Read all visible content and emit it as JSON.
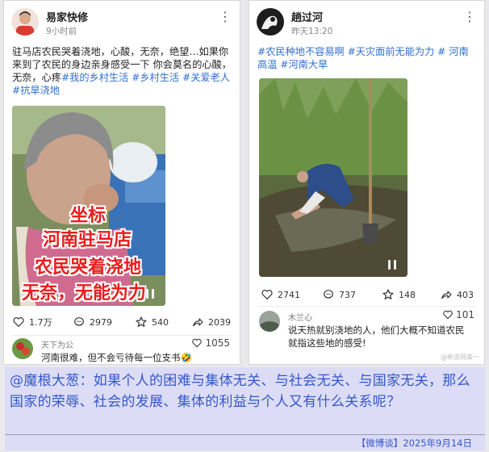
{
  "left_post": {
    "author": "易家快修",
    "time": "9小时前",
    "text": "驻马店农民哭着浇地，心酸，无奈，绝望…如果你来到了农民的身边亲身感受一下 你会莫名的心酸，无奈，心疼",
    "tags": "#我的乡村生活 #乡村生活 #关爱老人 #抗旱浇地",
    "video_caption": [
      "坐标",
      "河南驻马店",
      "农民哭着浇地",
      "无奈，无能为力"
    ],
    "actions": {
      "repost": "1.7万",
      "comments": "2979",
      "likes": "540",
      "shares": "2039"
    },
    "comment": {
      "user": "天下为公",
      "likes": "1055",
      "text": "河南很难，但不会亏待每一位支书🤣"
    }
  },
  "right_post": {
    "author": "趟过河",
    "time": "昨天13:20",
    "tags": "#农民种地不容易啊 #天灾面前无能为力 # 河南高温 #河南大旱",
    "actions": {
      "likes": "2741",
      "comments": "737",
      "favorites": "148",
      "shares": "403"
    },
    "comment": {
      "user": "木兰心",
      "likes": "101",
      "text": "说天热就别浇地的人，他们大概不知道农民就指这些地的感受!"
    },
    "watermark": "@新浪网美一"
  },
  "overlay": {
    "text": "@魔根大葱：如果个人的困难与集体无关、与社会无关、与国家无关，那么国家的荣辱、社会的发展、集体的利益与个人又有什么关系呢？"
  },
  "footer": {
    "source": "【微博谈】2025年9月14日"
  },
  "colors": {
    "tag_blue": "#2f6fcf",
    "overlay_bg": "#dcdcf6",
    "overlay_text": "#3558c9",
    "caption_red": "#e81d1d"
  }
}
